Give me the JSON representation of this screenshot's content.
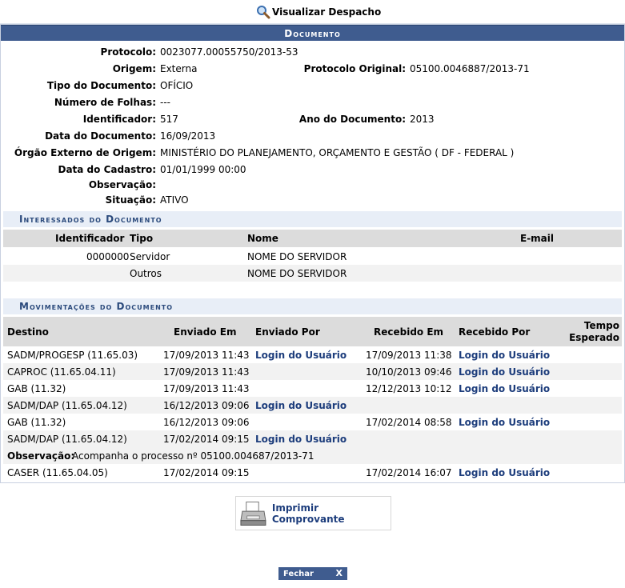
{
  "header": {
    "title": "Visualizar Despacho"
  },
  "documento": {
    "caption": "Documento",
    "fields": {
      "protocolo_label": "Protocolo:",
      "protocolo": "0023077.00055750/2013-53",
      "origem_label": "Origem:",
      "origem": "Externa",
      "protocolo_original_label": "Protocolo Original:",
      "protocolo_original": "05100.0046887/2013-71",
      "tipo_label": "Tipo do Documento:",
      "tipo": "OFÍCIO",
      "folhas_label": "Número de Folhas:",
      "folhas": "---",
      "identificador_label": "Identificador:",
      "identificador": "517",
      "ano_label": "Ano do Documento:",
      "ano": "2013",
      "data_doc_label": "Data do Documento:",
      "data_doc": "16/09/2013",
      "orgao_label": "Órgão Externo de Origem:",
      "orgao": "MINISTÉRIO DO PLANEJAMENTO, ORÇAMENTO E GESTÃO ( DF - FEDERAL )",
      "data_cad_label": "Data do Cadastro:",
      "data_cad": "01/01/1999 00:00",
      "obs_label": "Observação:",
      "obs": "",
      "situacao_label": "Situação:",
      "situacao": "ATIVO"
    }
  },
  "interessados": {
    "title": "Interessados do Documento",
    "headers": {
      "identificador": "Identificador",
      "tipo": "Tipo",
      "nome": "Nome",
      "email": "E-mail"
    },
    "rows": [
      {
        "identificador": "0000000",
        "tipo": "Servidor",
        "nome": "NOME DO SERVIDOR",
        "email": ""
      },
      {
        "identificador": "",
        "tipo": "Outros",
        "nome": "NOME DO SERVIDOR",
        "email": ""
      }
    ]
  },
  "movimentacoes": {
    "title": "Movimentações do Documento",
    "headers": {
      "destino": "Destino",
      "enviado_em": "Enviado Em",
      "enviado_por": "Enviado Por",
      "recebido_em": "Recebido Em",
      "recebido_por": "Recebido Por",
      "tempo_1": "Tempo",
      "tempo_2": "Esperado"
    },
    "rows": [
      {
        "destino": "SADM/PROGESP (11.65.03)",
        "enviado_em": "17/09/2013 11:43",
        "enviado_por": "Login do Usuário",
        "recebido_em": "17/09/2013 11:38",
        "recebido_por": "Login do Usuário"
      },
      {
        "destino": "CAPROC (11.65.04.11)",
        "enviado_em": "17/09/2013 11:43",
        "enviado_por": "",
        "recebido_em": "10/10/2013 09:46",
        "recebido_por": "Login do Usuário"
      },
      {
        "destino": "GAB (11.32)",
        "enviado_em": "17/09/2013 11:43",
        "enviado_por": "",
        "recebido_em": "12/12/2013 10:12",
        "recebido_por": "Login do Usuário"
      },
      {
        "destino": "SADM/DAP (11.65.04.12)",
        "enviado_em": "16/12/2013 09:06",
        "enviado_por": "Login do Usuário",
        "recebido_em": "",
        "recebido_por": ""
      },
      {
        "destino": "GAB (11.32)",
        "enviado_em": "16/12/2013 09:06",
        "enviado_por": "",
        "recebido_em": "17/02/2014 08:58",
        "recebido_por": "Login do Usuário"
      },
      {
        "destino": "SADM/DAP (11.65.04.12)",
        "enviado_em": "17/02/2014 09:15",
        "enviado_por": "Login do Usuário",
        "recebido_em": "",
        "recebido_por": ""
      }
    ],
    "observacao_label": "Observação:",
    "observacao": "Acompanha o processo nº 05100.004687/2013-71",
    "last_row": {
      "destino": "CASER (11.65.04.05)",
      "enviado_em": "17/02/2014 09:15",
      "enviado_por": "",
      "recebido_em": "17/02/2014 16:07",
      "recebido_por": "Login do Usuário"
    }
  },
  "actions": {
    "print_label": "Imprimir Comprovante",
    "close_label": "Fechar",
    "close_x": "X"
  }
}
